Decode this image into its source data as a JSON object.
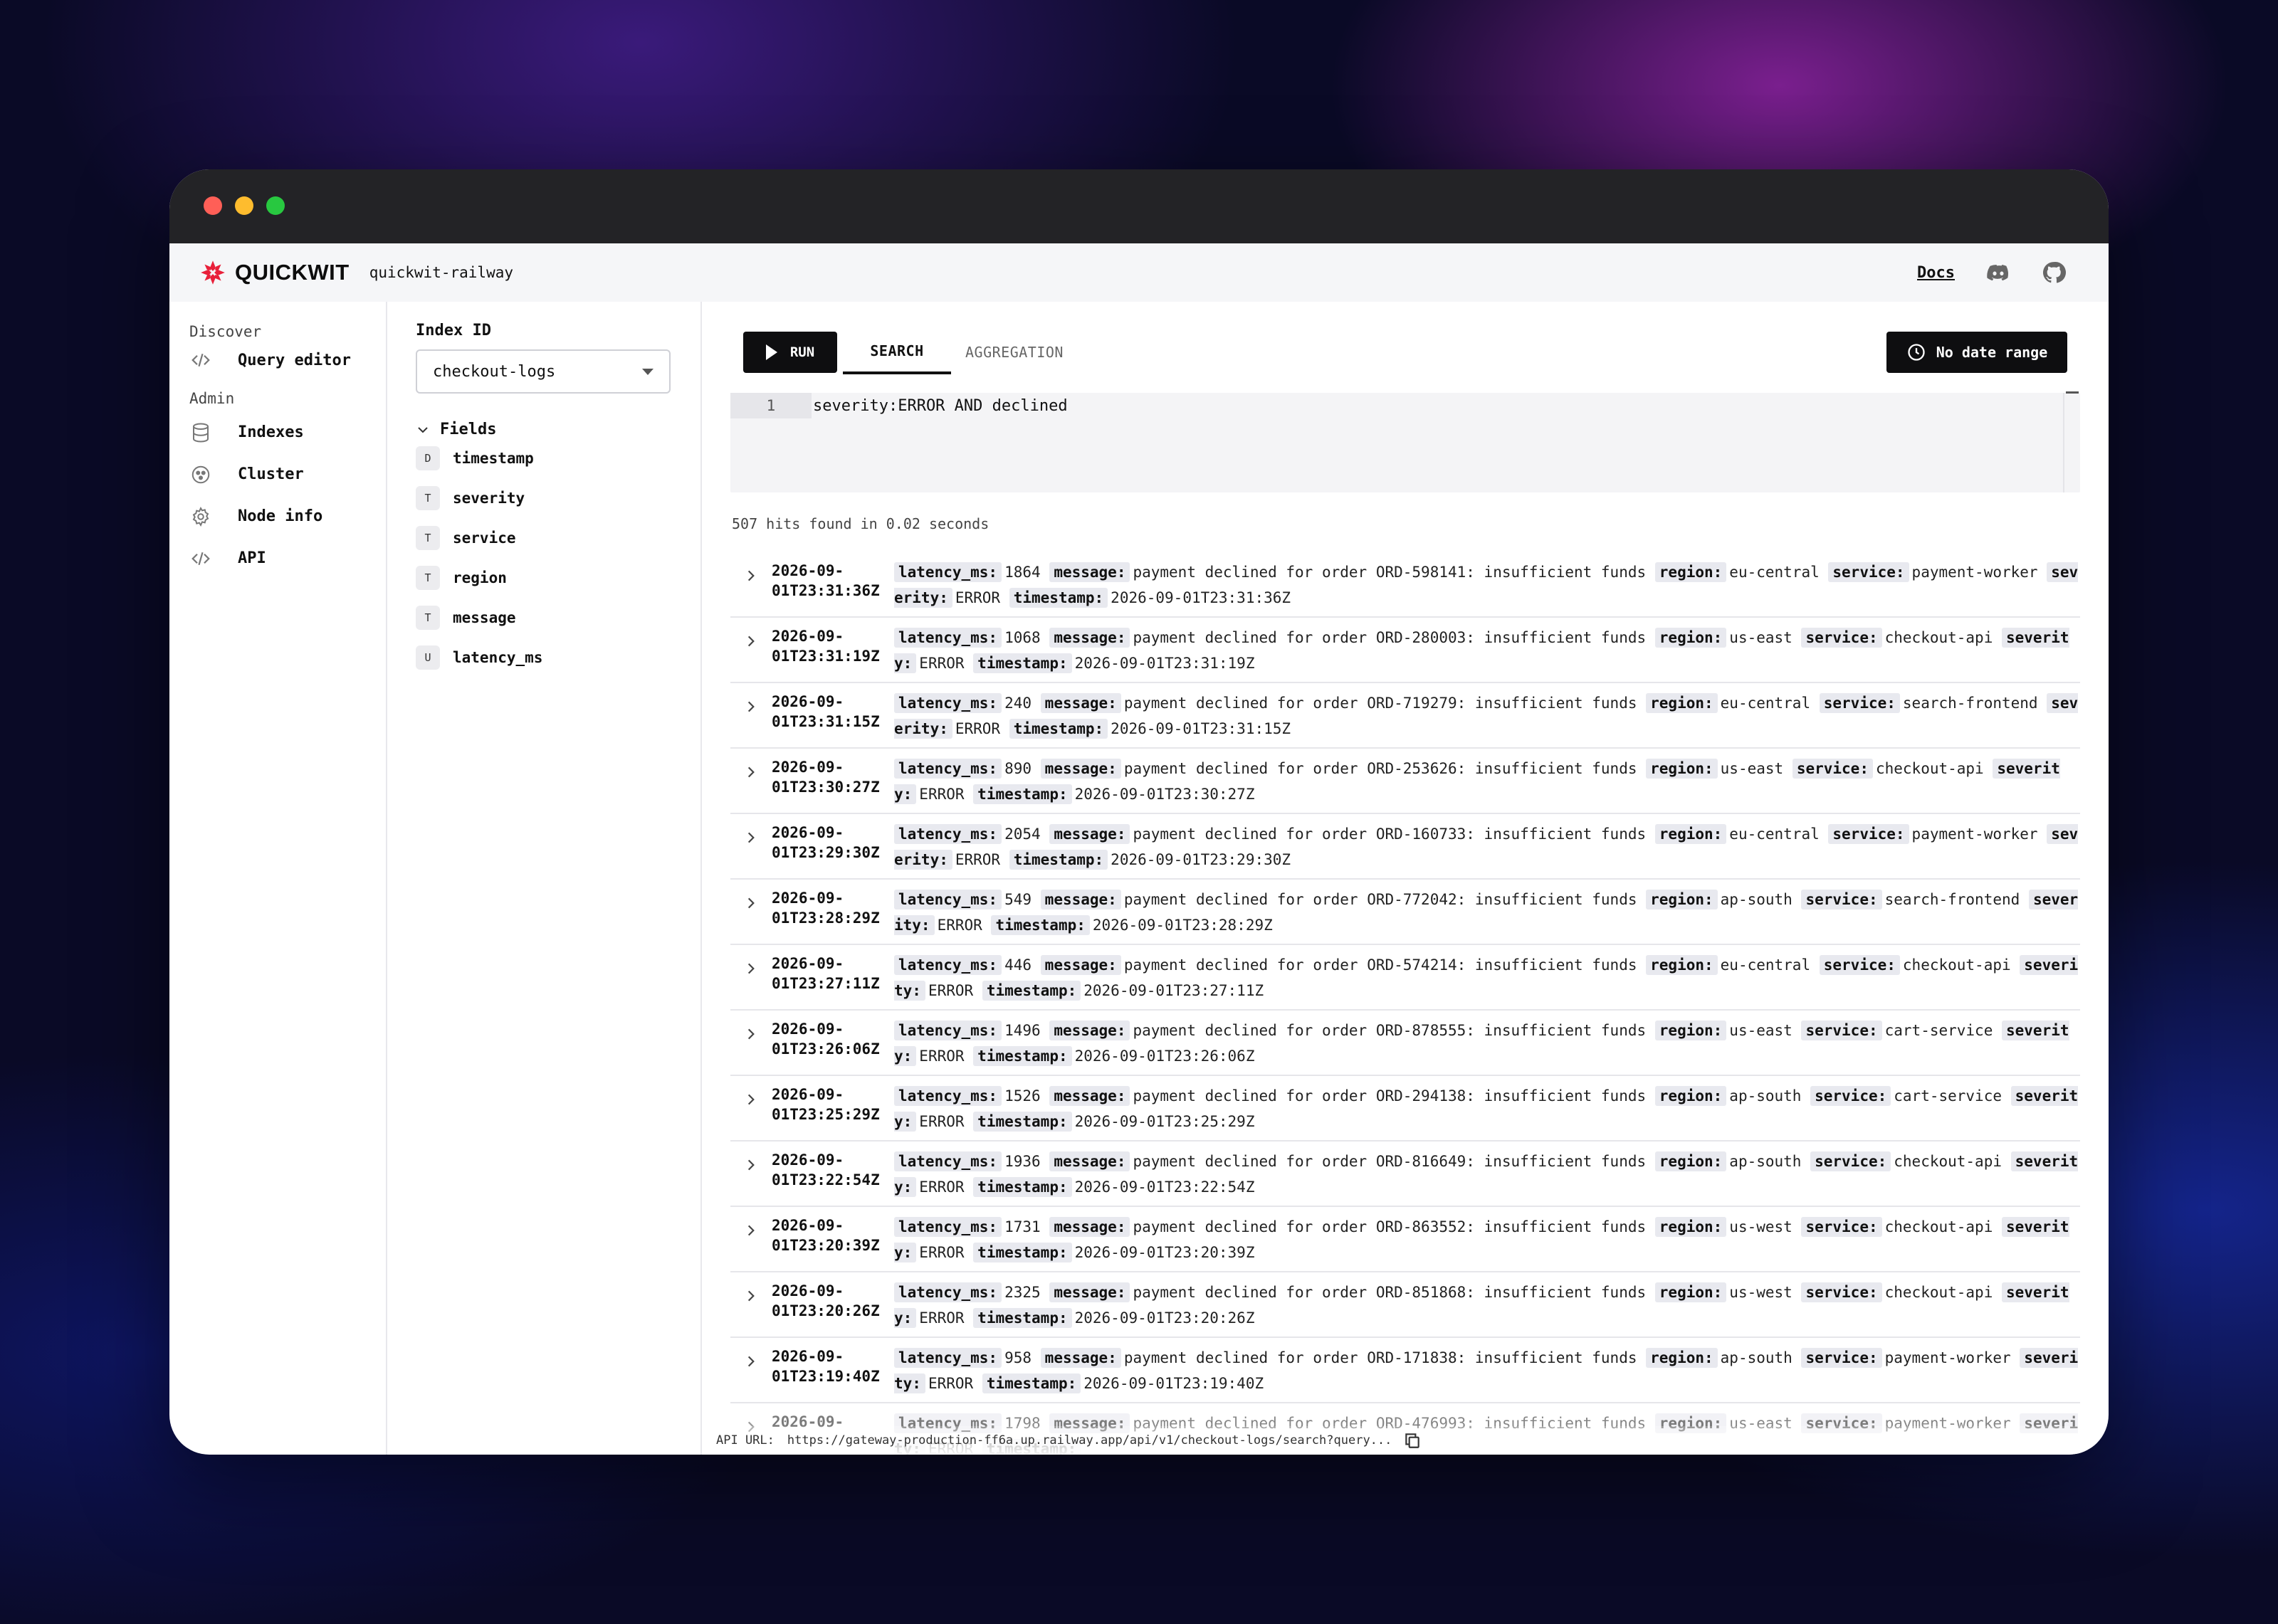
{
  "brand": {
    "name": "QUICKWIT",
    "cluster": "quickwit-railway"
  },
  "header": {
    "docs_label": "Docs",
    "icons": [
      "discord-icon",
      "github-icon"
    ]
  },
  "sidebar": {
    "discover_label": "Discover",
    "admin_label": "Admin",
    "items": [
      {
        "label": "Query editor",
        "icon": "code-icon"
      },
      {
        "label": "Indexes",
        "icon": "database-icon"
      },
      {
        "label": "Cluster",
        "icon": "cluster-icon"
      },
      {
        "label": "Node info",
        "icon": "gear-icon"
      },
      {
        "label": "API",
        "icon": "code-icon"
      }
    ]
  },
  "index_panel": {
    "label": "Index ID",
    "selected_index": "checkout-logs",
    "fields_label": "Fields",
    "fields": [
      {
        "type": "D",
        "name": "timestamp"
      },
      {
        "type": "T",
        "name": "severity"
      },
      {
        "type": "T",
        "name": "service"
      },
      {
        "type": "T",
        "name": "region"
      },
      {
        "type": "T",
        "name": "message"
      },
      {
        "type": "U",
        "name": "latency_ms"
      }
    ]
  },
  "toolbar": {
    "run_label": "RUN",
    "tab_search": "SEARCH",
    "tab_aggregation": "AGGREGATION",
    "date_range_label": "No date range"
  },
  "editor": {
    "line_number": "1",
    "query": "severity:ERROR AND declined"
  },
  "hits_text": "507 hits found in 0.02 seconds",
  "results": [
    {
      "ts1": "2026-09-",
      "ts2": "01T23:31:36Z",
      "latency_ms": "1864",
      "message": "payment declined for order ORD-598141: insufficient funds",
      "region": "eu-central",
      "service": "payment-worker",
      "severity": "ERROR",
      "timestamp": "2026-09-01T23:31:36Z"
    },
    {
      "ts1": "2026-09-",
      "ts2": "01T23:31:19Z",
      "latency_ms": "1068",
      "message": "payment declined for order ORD-280003: insufficient funds",
      "region": "us-east",
      "service": "checkout-api",
      "severity": "ERROR",
      "timestamp": "2026-09-01T23:31:19Z"
    },
    {
      "ts1": "2026-09-",
      "ts2": "01T23:31:15Z",
      "latency_ms": "240",
      "message": "payment declined for order ORD-719279: insufficient funds",
      "region": "eu-central",
      "service": "search-frontend",
      "severity": "ERROR",
      "timestamp": "2026-09-01T23:31:15Z"
    },
    {
      "ts1": "2026-09-",
      "ts2": "01T23:30:27Z",
      "latency_ms": "890",
      "message": "payment declined for order ORD-253626: insufficient funds",
      "region": "us-east",
      "service": "checkout-api",
      "severity": "ERROR",
      "timestamp": "2026-09-01T23:30:27Z"
    },
    {
      "ts1": "2026-09-",
      "ts2": "01T23:29:30Z",
      "latency_ms": "2054",
      "message": "payment declined for order ORD-160733: insufficient funds",
      "region": "eu-central",
      "service": "payment-worker",
      "severity": "ERROR",
      "timestamp": "2026-09-01T23:29:30Z"
    },
    {
      "ts1": "2026-09-",
      "ts2": "01T23:28:29Z",
      "latency_ms": "549",
      "message": "payment declined for order ORD-772042: insufficient funds",
      "region": "ap-south",
      "service": "search-frontend",
      "severity": "ERROR",
      "timestamp": "2026-09-01T23:28:29Z"
    },
    {
      "ts1": "2026-09-",
      "ts2": "01T23:27:11Z",
      "latency_ms": "446",
      "message": "payment declined for order ORD-574214: insufficient funds",
      "region": "eu-central",
      "service": "checkout-api",
      "severity": "ERROR",
      "timestamp": "2026-09-01T23:27:11Z"
    },
    {
      "ts1": "2026-09-",
      "ts2": "01T23:26:06Z",
      "latency_ms": "1496",
      "message": "payment declined for order ORD-878555: insufficient funds",
      "region": "us-east",
      "service": "cart-service",
      "severity": "ERROR",
      "timestamp": "2026-09-01T23:26:06Z"
    },
    {
      "ts1": "2026-09-",
      "ts2": "01T23:25:29Z",
      "latency_ms": "1526",
      "message": "payment declined for order ORD-294138: insufficient funds",
      "region": "ap-south",
      "service": "cart-service",
      "severity": "ERROR",
      "timestamp": "2026-09-01T23:25:29Z"
    },
    {
      "ts1": "2026-09-",
      "ts2": "01T23:22:54Z",
      "latency_ms": "1936",
      "message": "payment declined for order ORD-816649: insufficient funds",
      "region": "ap-south",
      "service": "checkout-api",
      "severity": "ERROR",
      "timestamp": "2026-09-01T23:22:54Z"
    },
    {
      "ts1": "2026-09-",
      "ts2": "01T23:20:39Z",
      "latency_ms": "1731",
      "message": "payment declined for order ORD-863552: insufficient funds",
      "region": "us-west",
      "service": "checkout-api",
      "severity": "ERROR",
      "timestamp": "2026-09-01T23:20:39Z"
    },
    {
      "ts1": "2026-09-",
      "ts2": "01T23:20:26Z",
      "latency_ms": "2325",
      "message": "payment declined for order ORD-851868: insufficient funds",
      "region": "us-west",
      "service": "checkout-api",
      "severity": "ERROR",
      "timestamp": "2026-09-01T23:20:26Z"
    },
    {
      "ts1": "2026-09-",
      "ts2": "01T23:19:40Z",
      "latency_ms": "958",
      "message": "payment declined for order ORD-171838: insufficient funds",
      "region": "ap-south",
      "service": "payment-worker",
      "severity": "ERROR",
      "timestamp": "2026-09-01T23:19:40Z"
    },
    {
      "ts1": "2026-09-",
      "ts2": "",
      "latency_ms": "1798",
      "message": "payment declined for order ORD-476993: insufficient funds",
      "region": "us-east",
      "service": "payment-worker",
      "severity": "ERROR",
      "timestamp": ""
    }
  ],
  "api_bar": {
    "label": "API URL:",
    "url": "https://gateway-production-ff6a.up.railway.app/api/v1/checkout-logs/search?query..."
  },
  "colors": {
    "brand_red": "#e8203a",
    "dark_button": "#0e0e10",
    "titlebar": "#232326"
  }
}
